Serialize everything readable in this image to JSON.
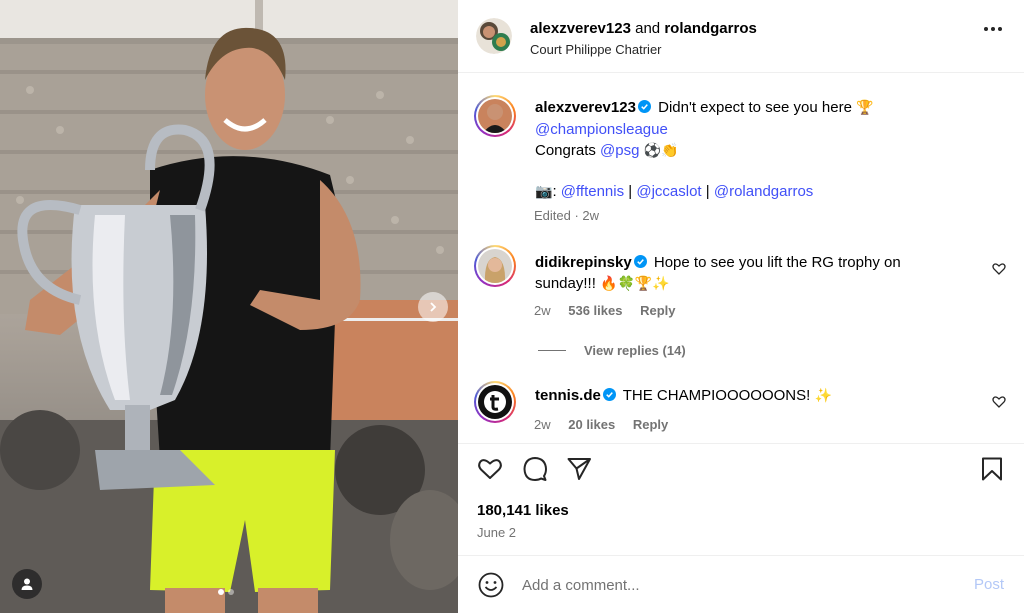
{
  "header": {
    "user1": "alexzverev123",
    "and_text": "and",
    "user2": "rolandgarros",
    "location": "Court Philippe Chatrier",
    "more_icon": "more-horizontal-icon"
  },
  "caption": {
    "username": "alexzverev123",
    "text_line1": "Didn't expect to see you here",
    "emoji_trophy": "🏆",
    "mention_cl": "@championsleague",
    "congrats": "Congrats",
    "mention_psg": "@psg",
    "emojis_psg": "⚽👏",
    "camera_emoji": "📷",
    "colon": ":",
    "mention_fft": "@fftennis",
    "sep1": "|",
    "mention_jcc": "@jccaslot",
    "sep2": "|",
    "mention_rg": "@rolandgarros",
    "meta": "Edited · 2w"
  },
  "comments": [
    {
      "username": "didikrepinsky",
      "text_line1": "Hope to see you lift the RG trophy on",
      "text_line2": "sunday!!!",
      "emojis": "🔥🍀🏆✨",
      "time": "2w",
      "likes": "536 likes",
      "reply": "Reply"
    },
    {
      "username": "tennis.de",
      "text": "THE CHAMPIOOOOOONS!",
      "emojis": "✨",
      "time": "2w",
      "likes": "20 likes",
      "reply": "Reply"
    }
  ],
  "view_replies": "View replies (14)",
  "stats": {
    "likes": "180,141 likes",
    "date": "June 2"
  },
  "add_comment": {
    "placeholder": "Add a comment...",
    "post_label": "Post"
  },
  "carousel": {
    "current": 1,
    "total": 2
  },
  "colors": {
    "mention": "#4150f7",
    "verified": "#0095f6",
    "post_disabled": "#b3c8f7",
    "muted": "#737373"
  }
}
